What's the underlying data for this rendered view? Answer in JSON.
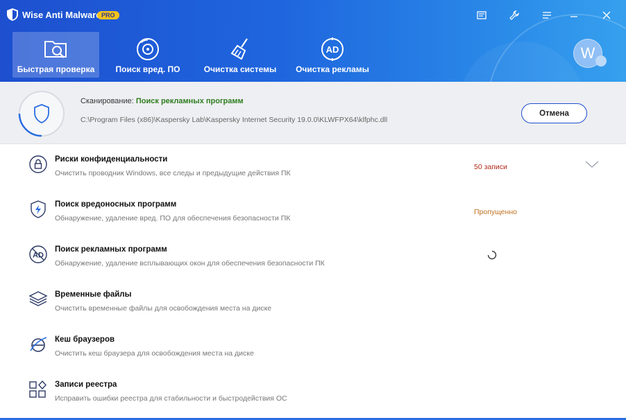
{
  "window": {
    "title": "Wise Anti Malware",
    "badge": "PRO"
  },
  "nav": [
    {
      "label": "Быстрая проверка",
      "icon": "folder-search-icon",
      "active": true
    },
    {
      "label": "Поиск вред. ПО",
      "icon": "target-scan-icon",
      "active": false
    },
    {
      "label": "Очистка системы",
      "icon": "broom-icon",
      "active": false
    },
    {
      "label": "Очистка рекламы",
      "icon": "ad-icon",
      "active": false
    }
  ],
  "user": {
    "avatar_letter": "W"
  },
  "scan": {
    "prefix": "Сканирование:",
    "stage": "Поиск рекламных программ",
    "path": "C:\\Program Files (x86)\\Kaspersky Lab\\Kaspersky Internet Security 19.0.0\\KLWFPX64\\klfphc.dll",
    "cancel_label": "Отмена"
  },
  "items": [
    {
      "title": "Риски конфиденциальности",
      "desc": "Очистить проводник Windows, все следы и предыдущие действия ПК",
      "status": "50 записи",
      "icon": "privacy-lock-icon"
    },
    {
      "title": "Поиск вредоносных программ",
      "desc": "Обнаружение, удаление вред. ПО для обеспечения безопасности ПК",
      "status": "Пропущенно",
      "icon": "shield-bolt-icon"
    },
    {
      "title": "Поиск рекламных программ",
      "desc": "Обнаружение, удаление всплывающих окон для обеспечения безопасности ПК",
      "status": "",
      "icon": "ad-blocked-icon"
    },
    {
      "title": "Временные файлы",
      "desc": "Очистить временные файлы для освобождения места на диске",
      "status": "",
      "icon": "layers-icon"
    },
    {
      "title": "Кеш браузеров",
      "desc": "Очистить кеш браузера для освобождения места на диске",
      "status": "",
      "icon": "browser-icon"
    },
    {
      "title": "Записи реестра",
      "desc": "Исправить ошибки реестра для стабильности и быстродействия ОС",
      "status": "",
      "icon": "registry-icon"
    }
  ],
  "colors": {
    "header_start": "#1d4fcf",
    "header_end": "#36a0ee",
    "stage_green": "#2e7d20",
    "count_red": "#b02a1a",
    "skipped_orange": "#c07020"
  }
}
